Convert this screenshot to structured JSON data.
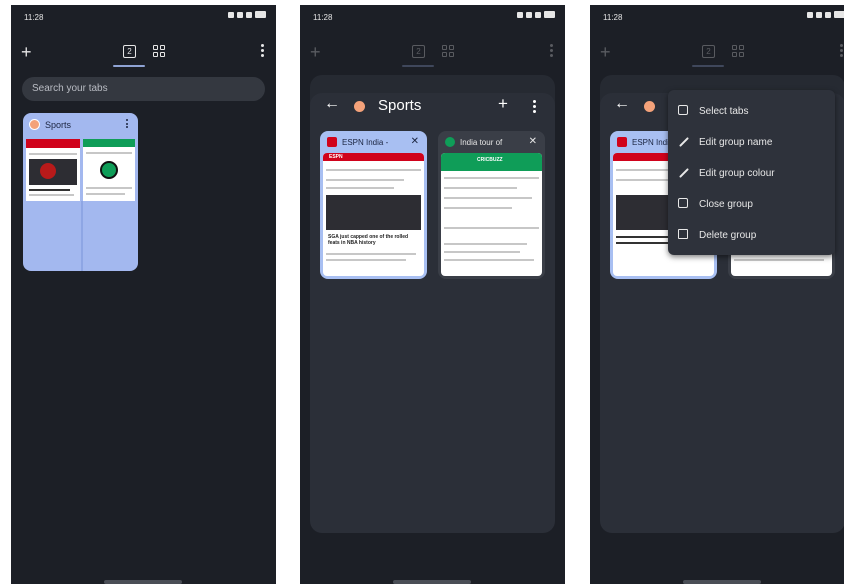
{
  "status": {
    "time": "11:28"
  },
  "toolbar": {
    "tab_count": "2"
  },
  "search": {
    "placeholder": "Search your tabs"
  },
  "group": {
    "name": "Sports"
  },
  "tabs": [
    {
      "title": "ESPN India -",
      "page_brand": "ESPN",
      "headline": "SGA just capped one of the rolled feats in NBA history"
    },
    {
      "title": "India tour of",
      "page_brand": "CRICBUZZ"
    }
  ],
  "menu": {
    "items": [
      {
        "label": "Select tabs",
        "icon": "checkbox-icon"
      },
      {
        "label": "Edit group name",
        "icon": "pencil-icon"
      },
      {
        "label": "Edit group colour",
        "icon": "eyedropper-icon"
      },
      {
        "label": "Close group",
        "icon": "close-box-icon"
      },
      {
        "label": "Delete group",
        "icon": "trash-icon"
      }
    ]
  },
  "colors": {
    "background": "#1c1f26",
    "group_accent": "#a3b8ef",
    "group_dot": "#f4a27a",
    "menu": "#2e323b"
  }
}
